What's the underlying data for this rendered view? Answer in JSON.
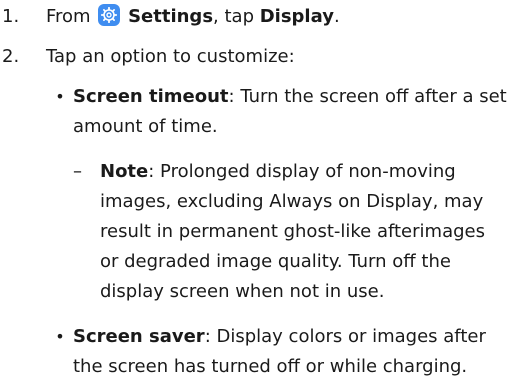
{
  "steps": [
    {
      "number": "1.",
      "prefix": "From ",
      "icon": "settings-gear-icon",
      "settings_label": "Settings",
      "middle": ", tap ",
      "display_label": "Display",
      "suffix": "."
    },
    {
      "number": "2.",
      "text": "Tap an option to customize:"
    }
  ],
  "options": [
    {
      "term": "Screen timeout",
      "line1_rest": ": Turn the screen off after a set",
      "line2": "amount of time."
    },
    {
      "term": "Screen saver",
      "line1_rest": ": Display colors or images after",
      "line2": "the screen has turned off or while charging."
    }
  ],
  "note": {
    "dash": "–",
    "label": "Note",
    "line1_rest": ": Prolonged display of non-moving",
    "line2": "images, excluding Always on Display, may",
    "line3": "result in permanent ghost-like afterimages",
    "line4": "or degraded image quality. Turn off the",
    "line5": "display screen when not in use."
  },
  "bullet_char": "•",
  "colors": {
    "text": "#1a1a1a",
    "settings_icon_bg": "#3f8df0"
  }
}
